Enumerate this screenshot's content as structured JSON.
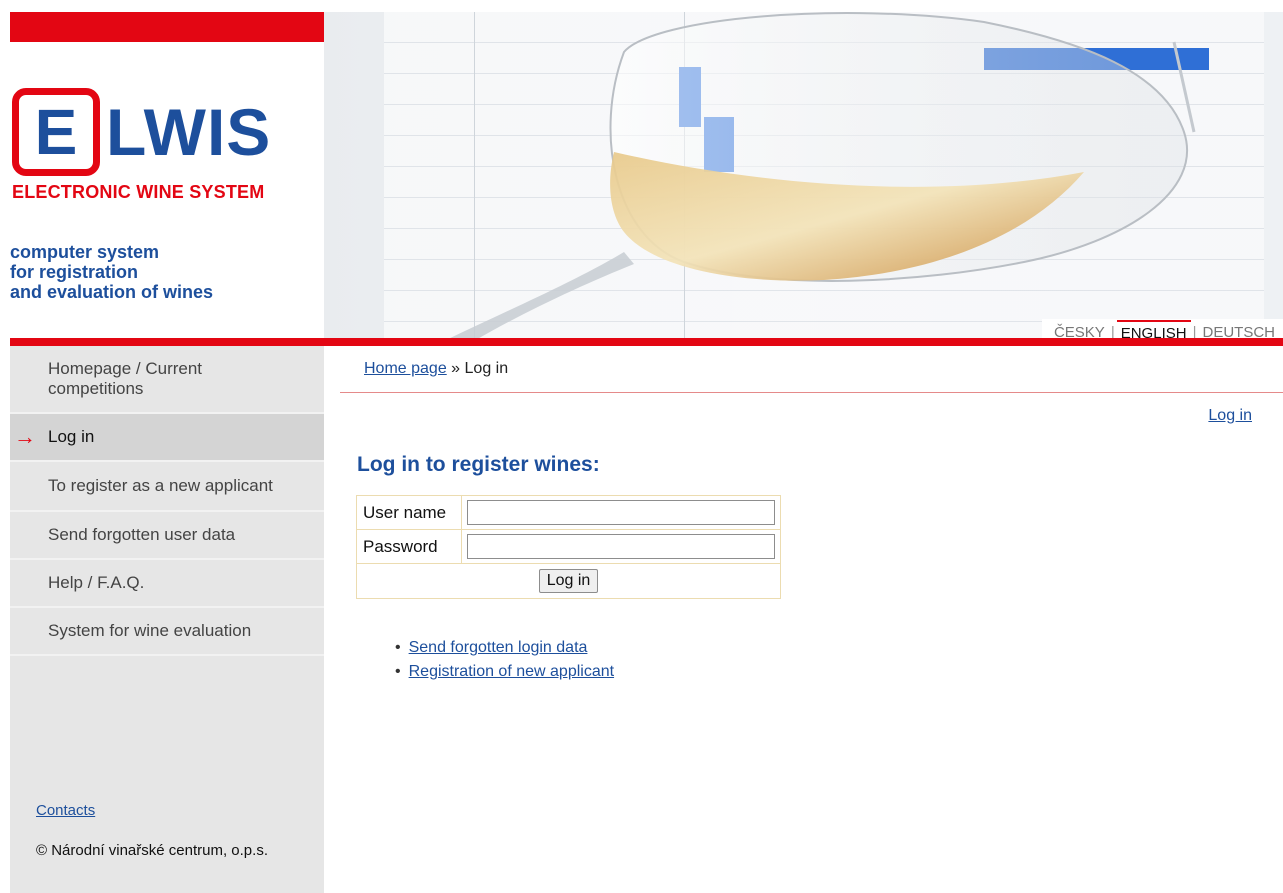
{
  "header": {
    "logo_letter": "E",
    "logo_rest": "LWIS",
    "logo_subtitle": "ELECTRONIC WINE SYSTEM",
    "tagline": [
      "computer system",
      "for registration",
      "and evaluation of wines"
    ],
    "languages": [
      {
        "label": "ČESKY",
        "active": false
      },
      {
        "label": "ENGLISH",
        "active": true
      },
      {
        "label": "DEUTSCH",
        "active": false
      }
    ],
    "language_separator": "|"
  },
  "sidebar": {
    "items": [
      {
        "label": "Homepage / Current competitions",
        "active": false
      },
      {
        "label": "Log in",
        "active": true
      },
      {
        "label": "To register as a new applicant",
        "active": false
      },
      {
        "label": "Send forgotten user data",
        "active": false
      },
      {
        "label": "Help / F.A.Q.",
        "active": false
      },
      {
        "label": "System for wine evaluation",
        "active": false
      }
    ],
    "active_arrow": "→",
    "contacts": "Contacts",
    "copyright": "© Národní vinařské centrum, o.p.s."
  },
  "main": {
    "breadcrumb": {
      "home": "Home page",
      "separator": "»",
      "current": "Log in"
    },
    "top_login_link": "Log in",
    "title": "Log in to register wines:",
    "form": {
      "username_label": "User name",
      "username_value": "",
      "password_label": "Password",
      "password_value": "",
      "submit_label": "Log in"
    },
    "links": [
      "Send forgotten login data",
      "Registration of new applicant"
    ]
  },
  "colors": {
    "brand_red": "#e30613",
    "brand_blue": "#1d4f9c",
    "sidebar_bg": "#e6e6e6"
  }
}
